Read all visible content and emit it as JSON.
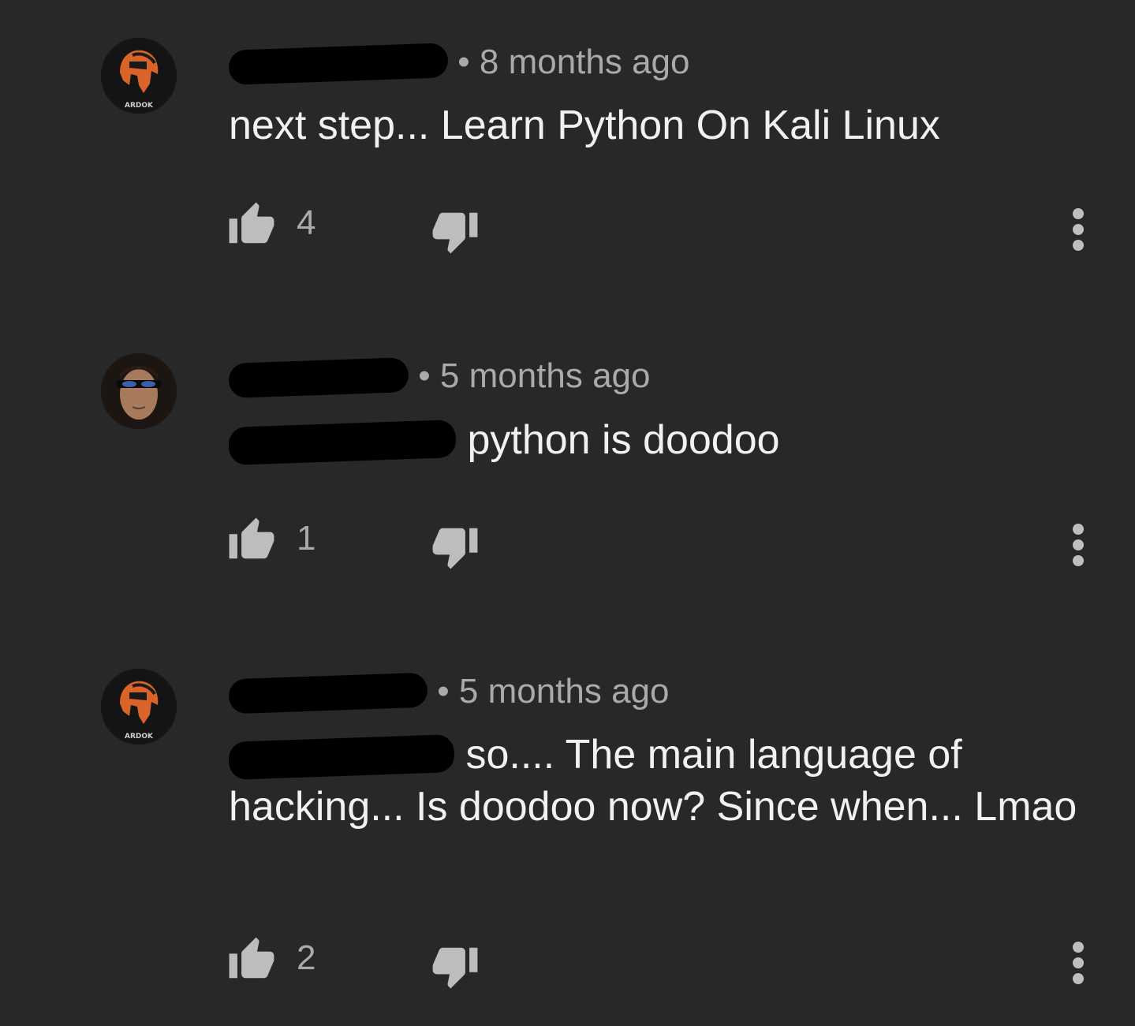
{
  "comments": [
    {
      "avatar": "spartan-helmet-logo",
      "avatar_label": "ARDOK",
      "time": "8 months ago",
      "mention": "",
      "text": "next step... Learn Python On Kali Linux",
      "likes": "4"
    },
    {
      "avatar": "sunglasses-man-photo",
      "avatar_label": "",
      "time": "5 months ago",
      "mention": "",
      "text": "python is doodoo",
      "likes": "1"
    },
    {
      "avatar": "spartan-helmet-logo",
      "avatar_label": "ARDOK",
      "time": "5 months ago",
      "mention": "",
      "text": "so.... The main language of hacking... Is doodoo now? Since when... Lmao",
      "likes": "2"
    }
  ],
  "colors": {
    "background": "#282828",
    "primary_text": "#f1f1f1",
    "secondary_text": "#aaaaaa",
    "mention": "#3ea6ff",
    "avatar_accent": "#d9642a"
  }
}
